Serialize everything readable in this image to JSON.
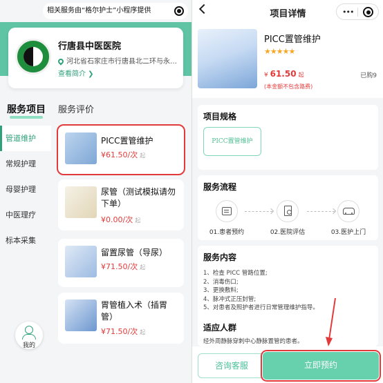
{
  "left": {
    "top_notice": "相关服务由“格尔护士”小程序提供",
    "hospital": {
      "name": "行唐县中医医院",
      "address": "河北省石家庄市行唐县北二环与永昌...",
      "intro_link": "查看简介 ❯"
    },
    "tabs": [
      "服务项目",
      "服务评价"
    ],
    "sidebar": [
      "管道维护",
      "常规护理",
      "母婴护理",
      "中医理疗",
      "标本采集"
    ],
    "services": [
      {
        "name": "PICC置管维护",
        "price": "¥61.50/次",
        "from": "起"
      },
      {
        "name": "尿管（测试模拟请勿下单）",
        "price": "¥0.00/次",
        "from": "起"
      },
      {
        "name": "留置尿管（导尿）",
        "price": "¥71.50/次",
        "from": "起"
      },
      {
        "name": "胃管植入术（插胃管）",
        "price": "¥71.50/次",
        "from": "起"
      }
    ],
    "me_label": "我的"
  },
  "right": {
    "nav_title": "项目详情",
    "capsule_dots": "•••",
    "product": {
      "title": "PICC置管维护",
      "stars": "★★★★★",
      "price_symbol": "¥ ",
      "price": "61.50",
      "price_from": "起",
      "sold": "已购9",
      "note": "(本金额不包含路费)"
    },
    "spec": {
      "title": "项目规格",
      "chip": "PICC置管维护"
    },
    "flow": {
      "title": "服务流程",
      "steps": [
        "01.患者预约",
        "02.医院评估",
        "03.医护上门"
      ]
    },
    "content": {
      "title": "服务内容",
      "items": [
        "1、检查 PICC 管路位置;",
        "2、消毒伤口;",
        "3、更换敷料;",
        "4、脉冲式正压封管;",
        "5、对患者及照护者进行日常管理维护指导。"
      ]
    },
    "audience": {
      "title": "适应人群",
      "text": "经外周静脉穿刺中心静脉置管的患者。"
    },
    "buttons": {
      "consult": "咨询客服",
      "book": "立即预约"
    }
  },
  "colors": {
    "brand": "#5fc4a4",
    "accent_red": "#e23a3a",
    "text_green": "#2ea17b"
  }
}
